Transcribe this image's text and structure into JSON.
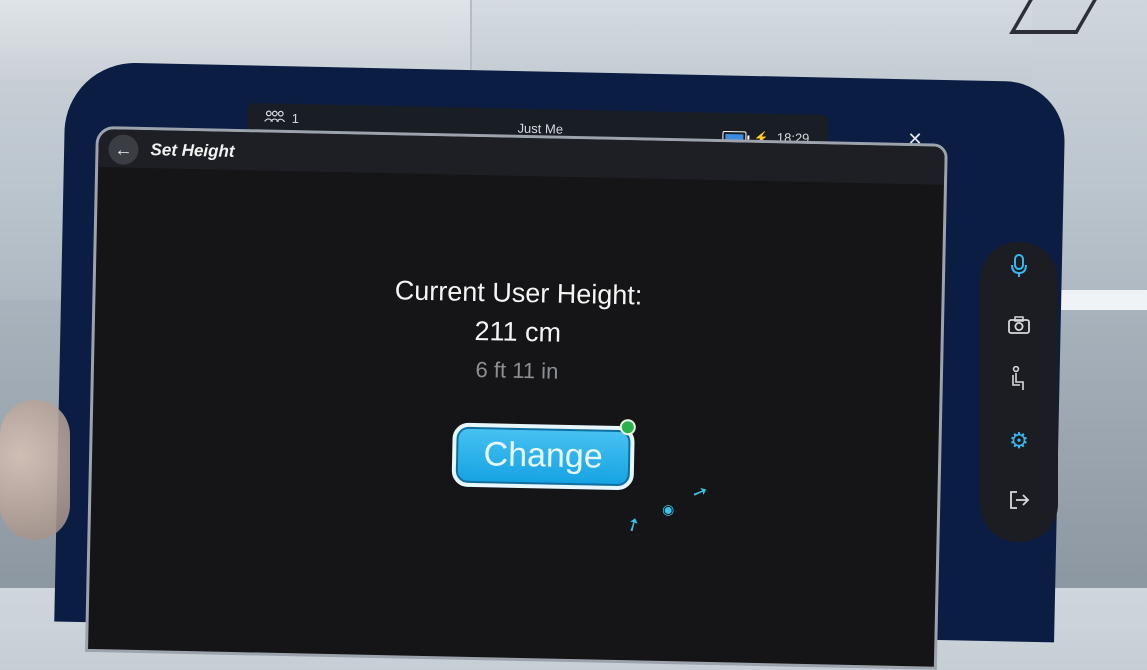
{
  "status_bar": {
    "user_count": "1",
    "session_name": "Just Me",
    "time": "18:29"
  },
  "panel": {
    "title": "Set Height",
    "height_label": "Current User Height:",
    "height_cm": "211 cm",
    "height_imperial": "6 ft 11 in",
    "change_button": "Change"
  },
  "icons": {
    "back": "back-arrow-icon",
    "close": "close-icon",
    "mic": "microphone-icon",
    "camera": "camera-icon",
    "seat": "seated-person-icon",
    "settings": "gear-icon",
    "exit": "exit-icon"
  },
  "colors": {
    "accent": "#39b6ef",
    "button": "#1aa6e4",
    "frame": "#0c1d44",
    "panel": "#151517"
  }
}
